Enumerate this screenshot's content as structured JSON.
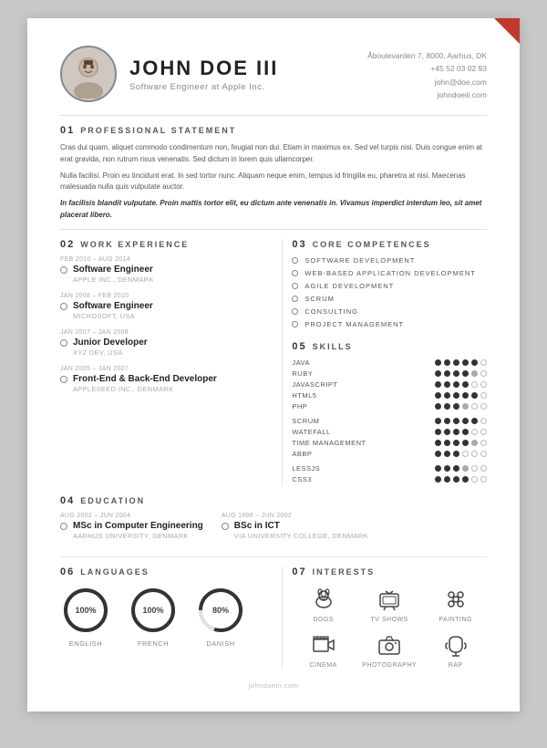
{
  "header": {
    "name": "JOHN DOE III",
    "subtitle": "Software Engineer at Apple Inc.",
    "address": "Åboulevarden 7, 8000, Aarhus, DK",
    "phone": "+45 52 03 02 93",
    "email": "john@doe.com",
    "website": "johndoeiii.com"
  },
  "sections": {
    "statement": {
      "num": "01",
      "title": "PROFESSIONAL STATEMENT",
      "paragraphs": [
        "Cras dui quam, aliquet commodo condimentum non, feugiat non dui. Etiam in maximus ex. Sed vel turpis nisi. Duis congue enim at erat gravida, non rutrum risus venenatis. Sed dictum in lorem quis ullamcorper.",
        "Nulla facilisi. Proin eu tincidunt erat. In sed tortor nunc. Aliquam neque enim, tempus id fringilla eu, pharetra at nisi. Maecenas malesuada nulla quis vulputate auctor.",
        "In facilisis blandit vulputate. Proin mattis tortor elit, eu dictum ante venenatis in. Vivamus imperdict interdum leo, sit amet placerat libero."
      ],
      "bold_italic_index": 2
    },
    "work_experience": {
      "num": "02",
      "title": "WORK EXPERIENCE",
      "items": [
        {
          "date": "FEB 2010 – AUG 2014",
          "title": "Software Engineer",
          "company": "APPLE INC., DENMARK"
        },
        {
          "date": "JAN 2008 – FEB 2010",
          "title": "Software Engineer",
          "company": "MICROSOFT, USA"
        },
        {
          "date": "JAN 2007 – JAN 2008",
          "title": "Junior Developer",
          "company": "XYZ DEV, USA"
        },
        {
          "date": "JAN 2005 – JAN 2007",
          "title": "Front-End & Back-End Developer",
          "company": "APPLESEED INC., DENMARK"
        }
      ]
    },
    "education": {
      "num": "04",
      "title": "EDUCATION",
      "items": [
        {
          "date": "AUG 2002 – JUN 2004",
          "title": "MSc in Computer Engineering",
          "company": "AARHUS UNIVERSITY, DENMARK"
        },
        {
          "date": "AUG 1998 – JUN 2002",
          "title": "BSc in ICT",
          "company": "VIA UNIVERSITY COLLEGE, DENMARK"
        }
      ]
    },
    "core_competences": {
      "num": "03",
      "title": "CORE COMPETENCES",
      "items": [
        "SOFTWARE DEVELOPMENT",
        "WEB-BASED APPLICATION DEVELOPMENT",
        "AGILE DEVELOPMENT",
        "SCRUM",
        "CONSULTING",
        "PROJECT MANAGEMENT"
      ]
    },
    "skills": {
      "num": "05",
      "title": "SKILLS",
      "groups": [
        {
          "items": [
            {
              "name": "JAVA",
              "filled": 5,
              "half": 0,
              "empty": 1
            },
            {
              "name": "RUBY",
              "filled": 4,
              "half": 1,
              "empty": 1
            },
            {
              "name": "JAVASCRIPT",
              "filled": 4,
              "half": 0,
              "empty": 2
            },
            {
              "name": "HTML5",
              "filled": 5,
              "half": 0,
              "empty": 1
            },
            {
              "name": "PHP",
              "filled": 3,
              "half": 1,
              "empty": 2
            }
          ]
        },
        {
          "items": [
            {
              "name": "SCRUM",
              "filled": 5,
              "half": 0,
              "empty": 1
            },
            {
              "name": "WATEFALL",
              "filled": 4,
              "half": 0,
              "empty": 2
            },
            {
              "name": "TIME MANAGEMENT",
              "filled": 4,
              "half": 1,
              "empty": 1
            },
            {
              "name": "ABBP",
              "filled": 3,
              "half": 0,
              "empty": 3
            }
          ]
        },
        {
          "items": [
            {
              "name": "LESSJS",
              "filled": 3,
              "half": 1,
              "empty": 2
            },
            {
              "name": "CSS3",
              "filled": 4,
              "half": 0,
              "empty": 2
            }
          ]
        }
      ]
    },
    "languages": {
      "num": "06",
      "title": "LANGUAGES",
      "items": [
        {
          "name": "ENGLISH",
          "percent": 100
        },
        {
          "name": "FRENCH",
          "percent": 100
        },
        {
          "name": "DANISH",
          "percent": 80
        }
      ]
    },
    "interests": {
      "num": "07",
      "title": "INTERESTS",
      "items": [
        {
          "name": "DOGS",
          "icon": "dogs"
        },
        {
          "name": "TV SHOWS",
          "icon": "tv"
        },
        {
          "name": "PAINTING",
          "icon": "painting"
        },
        {
          "name": "CINEMA",
          "icon": "cinema"
        },
        {
          "name": "PHOTOGRAPHY",
          "icon": "photography"
        },
        {
          "name": "RAP",
          "icon": "rap"
        }
      ]
    }
  },
  "footer": {
    "website": "johndoeiii.com"
  }
}
